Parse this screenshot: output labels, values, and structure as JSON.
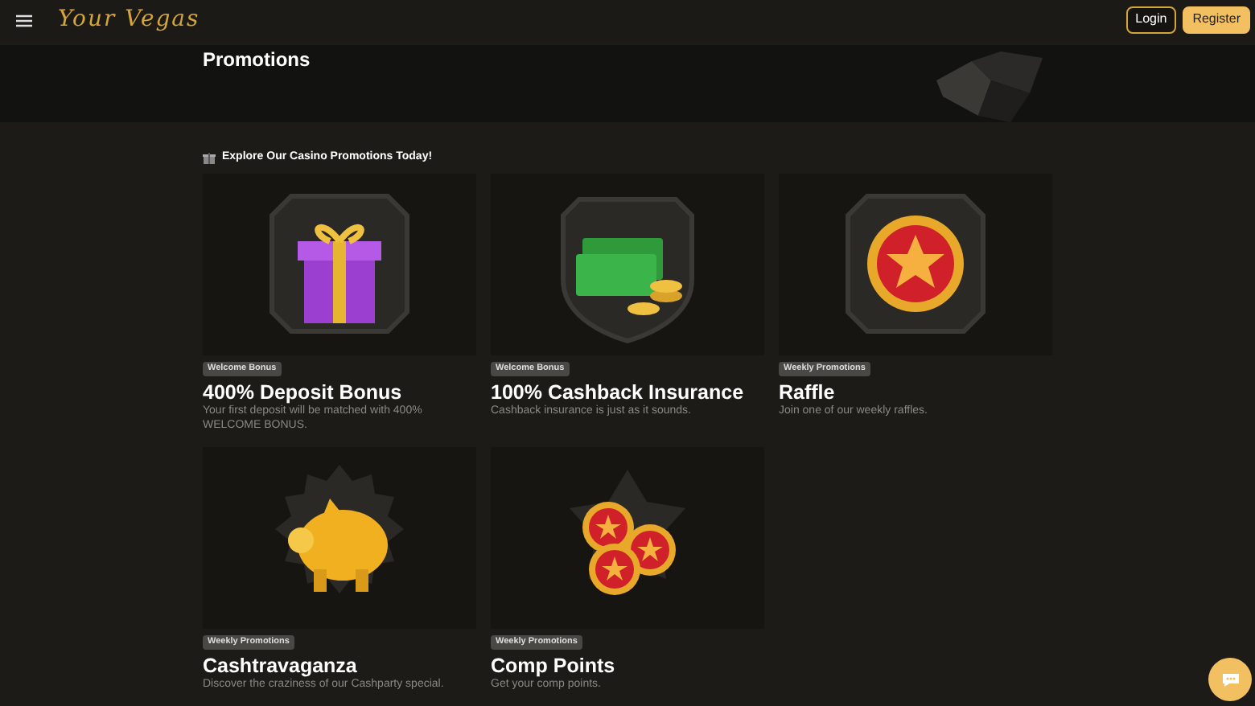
{
  "header": {
    "logo": "Your Vegas",
    "buttons": [
      {
        "label": "Login",
        "kind": "outline"
      },
      {
        "label": "Register",
        "kind": "solid"
      }
    ]
  },
  "hero": {
    "title": "Promotions"
  },
  "section": {
    "heading": "Explore Our Casino Promotions Today!"
  },
  "promotions": [
    {
      "kind": "gift",
      "tag": "Welcome Bonus",
      "title": "400% Deposit Bonus",
      "text": "Your first deposit will be matched with 400% WELCOME BONUS."
    },
    {
      "kind": "cash",
      "tag": "Welcome Bonus",
      "title": "100% Cashback Insurance",
      "text": "Cashback insurance is just as it sounds."
    },
    {
      "kind": "star",
      "tag": "Weekly Promotions",
      "title": "Raffle",
      "text": "Join one of our weekly raffles."
    },
    {
      "kind": "piggy",
      "tag": "Weekly Promotions",
      "title": "Cashtravaganza",
      "text": "Discover the craziness of our Cashparty special."
    },
    {
      "kind": "coins",
      "tag": "Weekly Promotions",
      "title": "Comp Points",
      "text": "Get your comp points."
    }
  ]
}
